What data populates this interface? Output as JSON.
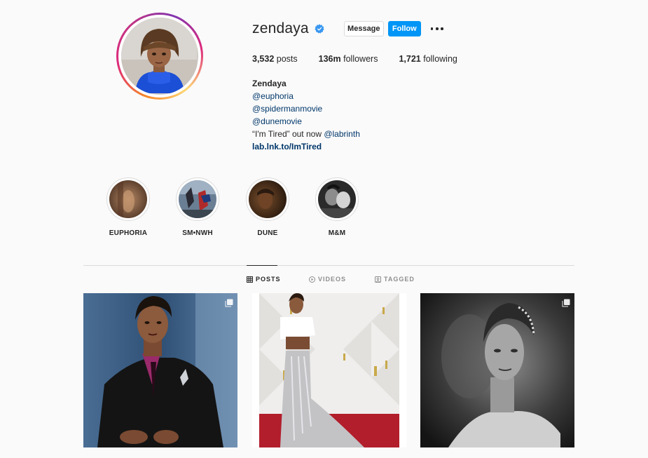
{
  "profile": {
    "username": "zendaya",
    "verified": true,
    "message_label": "Message",
    "follow_label": "Follow",
    "stats": {
      "posts_count": "3,532",
      "posts_label": "posts",
      "followers_count": "136m",
      "followers_label": "followers",
      "following_count": "1,721",
      "following_label": "following"
    },
    "bio": {
      "name": "Zendaya",
      "line1": "@euphoria",
      "line2": "@spidermanmovie",
      "line3": "@dunemovie",
      "line4_text": "“I'm Tired” out now ",
      "line4_link": "@labrinth",
      "url": "lab.lnk.to/ImTired"
    }
  },
  "highlights": [
    {
      "label": "EUPHORIA"
    },
    {
      "label": "SM•NWH"
    },
    {
      "label": "DUNE"
    },
    {
      "label": "M&M"
    }
  ],
  "tabs": [
    {
      "label": "POSTS",
      "icon": "grid-icon",
      "active": true
    },
    {
      "label": "VIDEOS",
      "icon": "play-icon",
      "active": false
    },
    {
      "label": "TAGGED",
      "icon": "tag-icon",
      "active": false
    }
  ],
  "colors": {
    "follow_button": "#0095f6",
    "verified_badge": "#3897f0",
    "link": "#00376b",
    "background": "#fafafa"
  }
}
